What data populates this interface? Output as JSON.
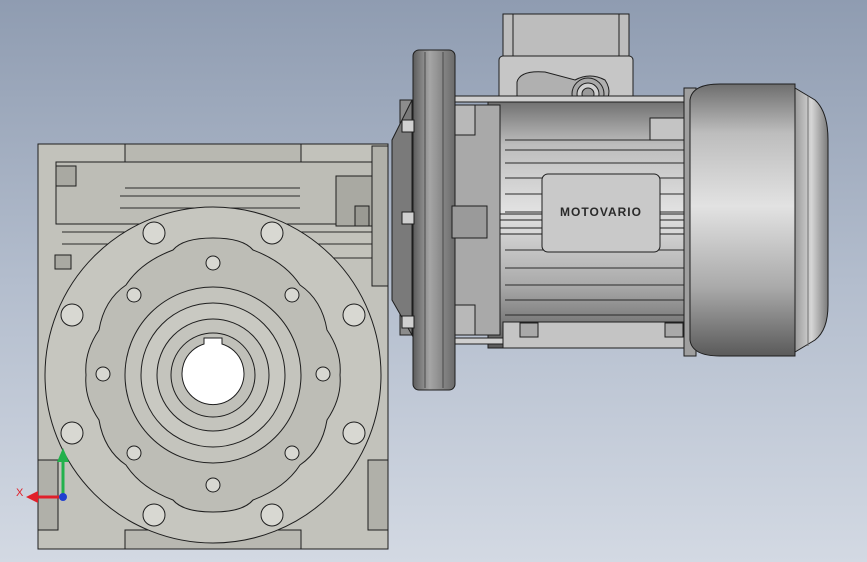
{
  "model": {
    "brand_label": "MOTOVARIO"
  },
  "triad": {
    "x_label": "X",
    "x_color": "#e0202a",
    "y_color": "#22b14c",
    "z_color": "#2040d0"
  },
  "colors": {
    "gearbox_body": "#c2c2bb",
    "motor_body": "#b9b9b9",
    "outline": "#1e1e1e",
    "viewport_top": "#8f9cb1",
    "viewport_bottom": "#d3d9e3"
  }
}
